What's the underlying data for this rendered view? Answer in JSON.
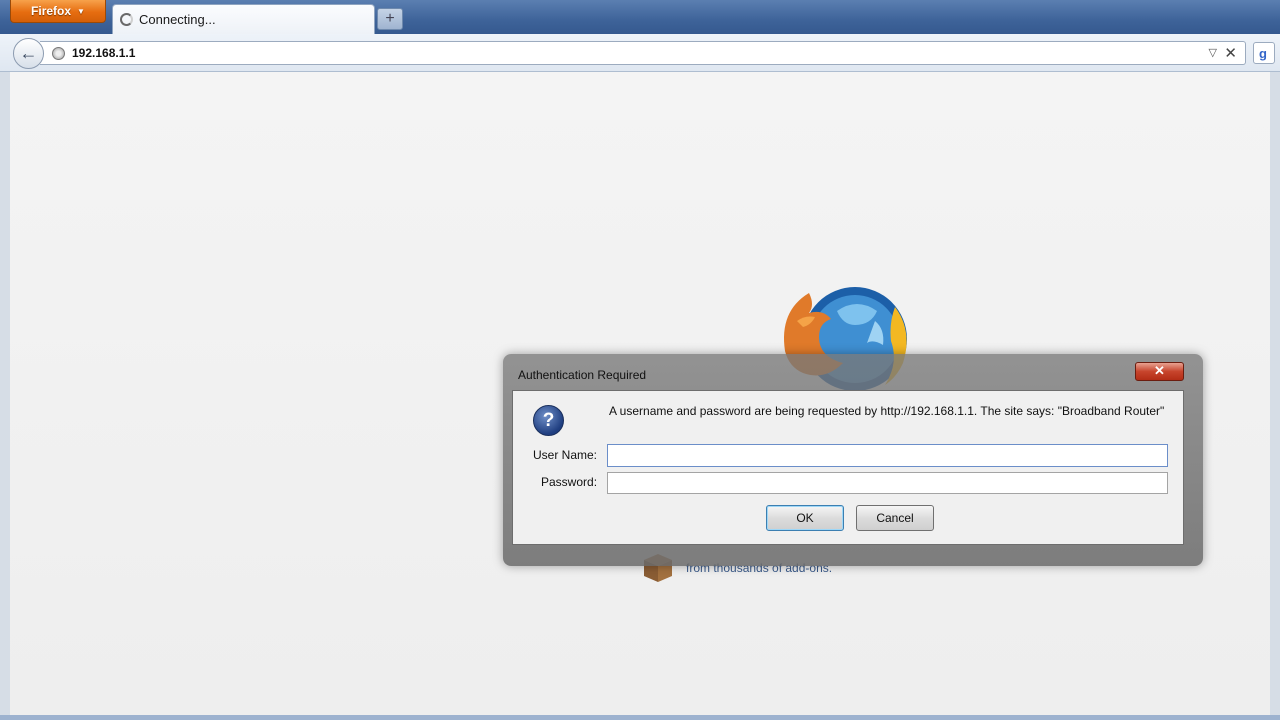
{
  "browser": {
    "menu_button_label": "Firefox",
    "tab": {
      "title": "Connecting..."
    },
    "new_tab_label": "+",
    "url": "192.168.1.1",
    "url_dropdown": "▽",
    "url_stop": "✕",
    "search_engine_icon": "g",
    "back_icon": "←"
  },
  "page": {
    "addon_text": "from thousands of add-ons."
  },
  "dialog": {
    "title": "Authentication Required",
    "close_glyph": "✕",
    "question_glyph": "?",
    "message": "A username and password are being requested by http://192.168.1.1. The site says: \"Broadband Router\"",
    "username_label": "User Name:",
    "username_value": "",
    "password_label": "Password:",
    "password_value": "",
    "ok_label": "OK",
    "cancel_label": "Cancel"
  },
  "colors": {
    "firefox_button": "#e66d10",
    "tab_strip": "#3e6399",
    "close_button": "#c7442c",
    "page_background": "#efefef"
  }
}
